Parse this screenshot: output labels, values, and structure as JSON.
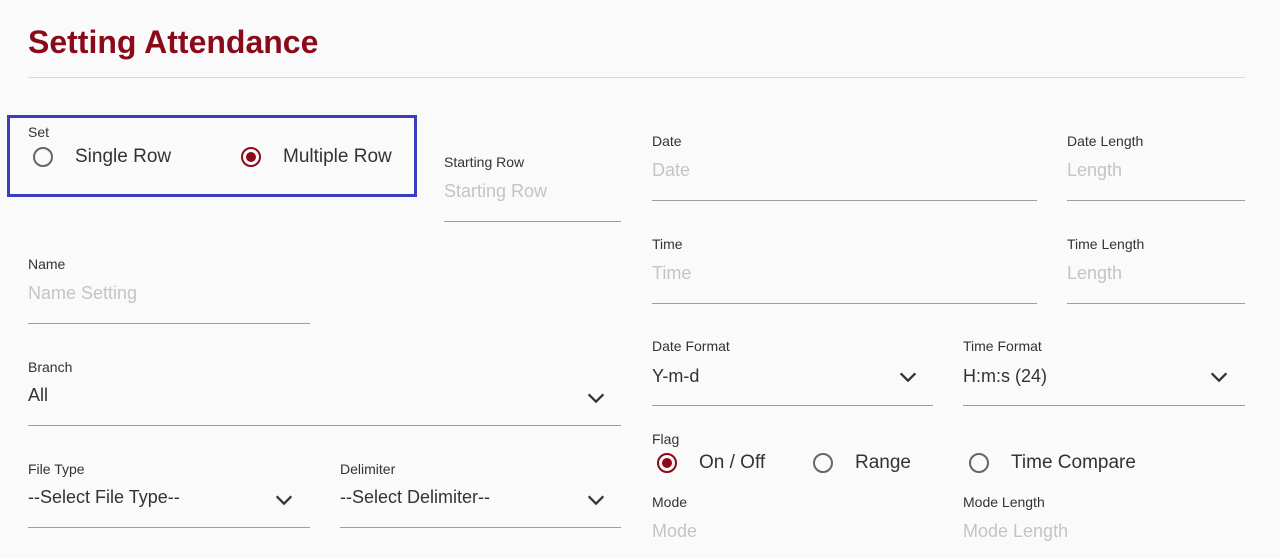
{
  "page": {
    "title": "Setting Attendance"
  },
  "set": {
    "label": "Set",
    "options": [
      {
        "label": "Single Row",
        "checked": false
      },
      {
        "label": "Multiple Row",
        "checked": true
      }
    ]
  },
  "starting_row": {
    "label": "Starting Row",
    "placeholder": "Starting Row"
  },
  "date": {
    "label": "Date",
    "placeholder": "Date"
  },
  "date_length": {
    "label": "Date Length",
    "placeholder": "Length"
  },
  "time": {
    "label": "Time",
    "placeholder": "Time"
  },
  "time_length": {
    "label": "Time Length",
    "placeholder": "Length"
  },
  "name": {
    "label": "Name",
    "placeholder": "Name Setting"
  },
  "branch": {
    "label": "Branch",
    "value": "All"
  },
  "date_format": {
    "label": "Date Format",
    "value": "Y-m-d"
  },
  "time_format": {
    "label": "Time Format",
    "value": "H:m:s (24)"
  },
  "flag": {
    "label": "Flag",
    "options": [
      {
        "label": "On / Off",
        "checked": true
      },
      {
        "label": "Range",
        "checked": false
      },
      {
        "label": "Time Compare",
        "checked": false
      }
    ]
  },
  "file_type": {
    "label": "File Type",
    "value": "--Select File Type--"
  },
  "delimiter": {
    "label": "Delimiter",
    "value": "--Select Delimiter--"
  },
  "mode": {
    "label": "Mode",
    "placeholder": "Mode"
  },
  "mode_length": {
    "label": "Mode Length",
    "placeholder": "Mode Length"
  },
  "colors": {
    "accent": "#8b0a1a",
    "highlight_border": "#3b3fbf"
  },
  "icons": {
    "dropdown": "chevron-down-icon",
    "radio": "radio-button-icon"
  }
}
